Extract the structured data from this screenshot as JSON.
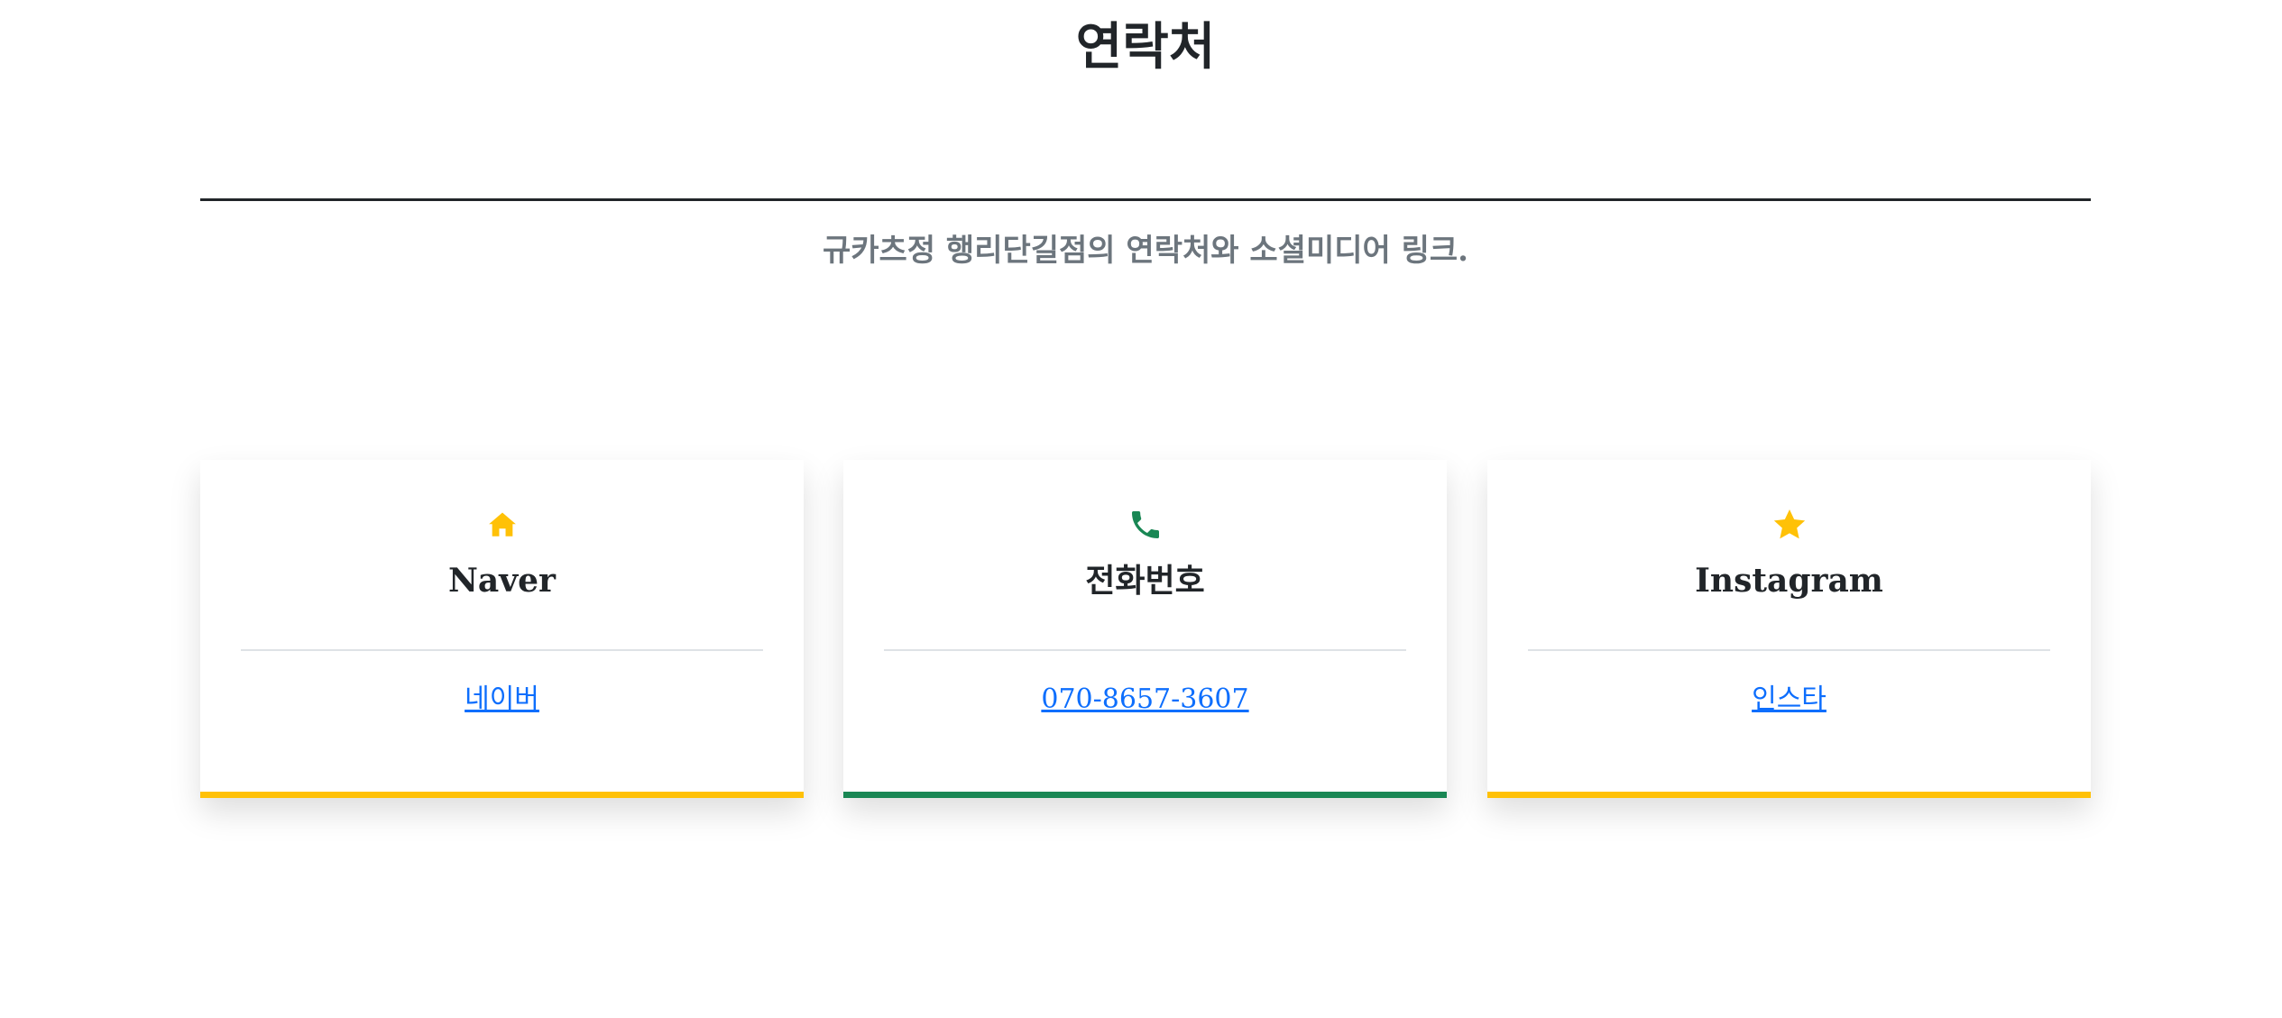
{
  "header": {
    "title": "연락처",
    "subtitle": "규카츠정 행리단길점의 연락처와 소셜미디어 링크."
  },
  "colors": {
    "accent_yellow": "#ffc107",
    "accent_green": "#198754",
    "link": "#0d6efd",
    "subtitle": "#6c757d"
  },
  "cards": [
    {
      "icon": "house-icon",
      "title": "Naver",
      "link_text": "네이버",
      "accent": "#ffc107"
    },
    {
      "icon": "phone-icon",
      "title": "전화번호",
      "link_text": "070-8657-3607",
      "accent": "#198754"
    },
    {
      "icon": "star-icon",
      "title": "Instagram",
      "link_text": "인스타",
      "accent": "#ffc107"
    }
  ]
}
